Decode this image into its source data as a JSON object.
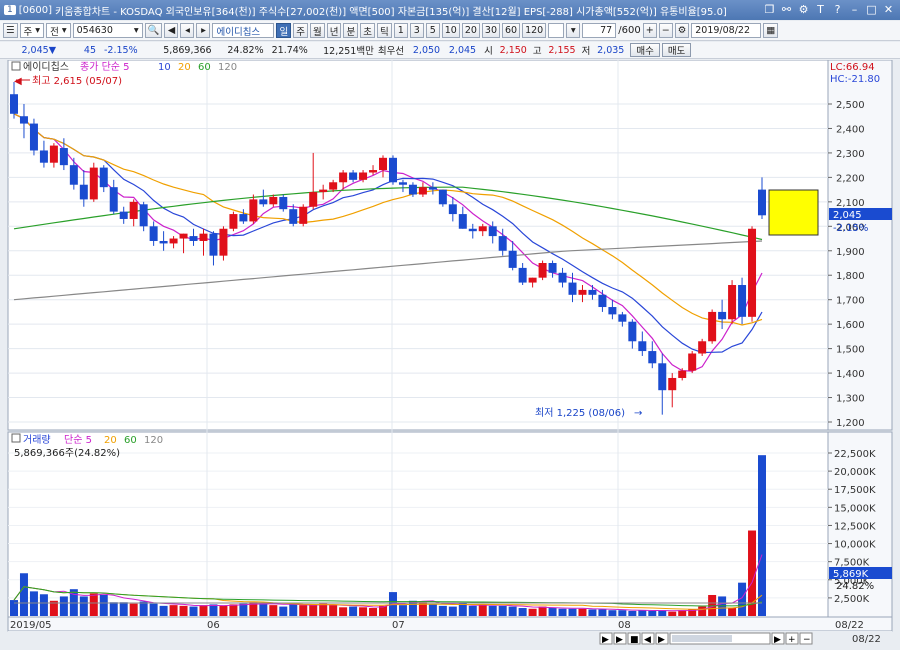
{
  "window": {
    "screen_no": "[0600]",
    "title": "키움종합차트 - KOSDAQ 외국인보유[364(천)] 주식수[27,002(천)] 액면[500] 자본금[135(억)] 결산[12월] EPS[-288] 시가총액[552(억)] 유통비율[95.0]",
    "icon_label": "1"
  },
  "toolbar": {
    "period_type": "주",
    "all_label": "전",
    "stock_code": "054630",
    "stock_name": "에이디칩스",
    "tabs": [
      "일",
      "주",
      "월",
      "년",
      "분",
      "초",
      "틱"
    ],
    "selected_tab": "일",
    "intervals": [
      "1",
      "3",
      "5",
      "10",
      "20",
      "30",
      "60",
      "120"
    ],
    "count": "77",
    "count_total": "/600",
    "date": "2019/08/22"
  },
  "quote": {
    "price": "2,045",
    "change": "45",
    "change_pct": "-2.15%",
    "volume": "5,869,366",
    "turnover_pct": "24.82%",
    "ratio2": "21.74%",
    "amount": "12,251백만",
    "best_bid_label": "최우선",
    "best_bid": "2,050",
    "best_ask": "2,045",
    "open_label": "시",
    "open": "2,150",
    "high_label": "고",
    "high": "2,155",
    "low_label": "저",
    "low": "2,035",
    "buy_label": "매수",
    "sell_label": "매도"
  },
  "price_panel": {
    "legend_name": "에이디칩스",
    "legend_items": [
      {
        "text": "종가 단순 5",
        "color": "#cc22cc"
      },
      {
        "text": "10",
        "color": "#2a47d8"
      },
      {
        "text": "20",
        "color": "#f0a000"
      },
      {
        "text": "60",
        "color": "#2aa02a"
      },
      {
        "text": "120",
        "color": "#888888"
      }
    ],
    "high_marker": "최고 2,615 (05/07)",
    "low_marker": "최저 1,225 (08/06)",
    "lc": "LC:66.94",
    "hc": "HC:-21.80",
    "current_price_tag": "2,045",
    "current_pct_tag": "-2.15%",
    "y_ticks": [
      "2,500",
      "2,400",
      "2,300",
      "2,200",
      "2,100",
      "2,000",
      "1,900",
      "1,800",
      "1,700",
      "1,600",
      "1,500",
      "1,400",
      "1,300",
      "1,200"
    ]
  },
  "volume_panel": {
    "legend_name": "거래량",
    "legend_items": [
      {
        "text": "단순 5",
        "color": "#cc22cc"
      },
      {
        "text": "20",
        "color": "#f0a000"
      },
      {
        "text": "60",
        "color": "#2aa02a"
      },
      {
        "text": "120",
        "color": "#888888"
      }
    ],
    "current_volume_text": "5,869,366주(24.82%)",
    "volume_tag": "5,869K",
    "pct_tag": "24.82%",
    "y_ticks": [
      "22,500K",
      "20,000K",
      "17,500K",
      "15,000K",
      "12,500K",
      "10,000K",
      "7,500K",
      "5,000K",
      "2,500K"
    ]
  },
  "x_axis": {
    "labels": [
      "2019/05",
      "06",
      "07",
      "08"
    ],
    "right_label": "08/22",
    "right_label2": "08/22"
  },
  "colors": {
    "up": "#e0101a",
    "down": "#1a4bd0",
    "ma5": "#cc22cc",
    "ma10": "#2a47d8",
    "ma20": "#f0a000",
    "ma60": "#2aa02a",
    "ma120": "#888888",
    "yellow_box": "#ffff00"
  },
  "chart_data": {
    "type": "candlestick",
    "candles_count": 76,
    "price_range": [
      1180,
      2600
    ],
    "high": 2615,
    "low": 1225,
    "last": 2045
  }
}
